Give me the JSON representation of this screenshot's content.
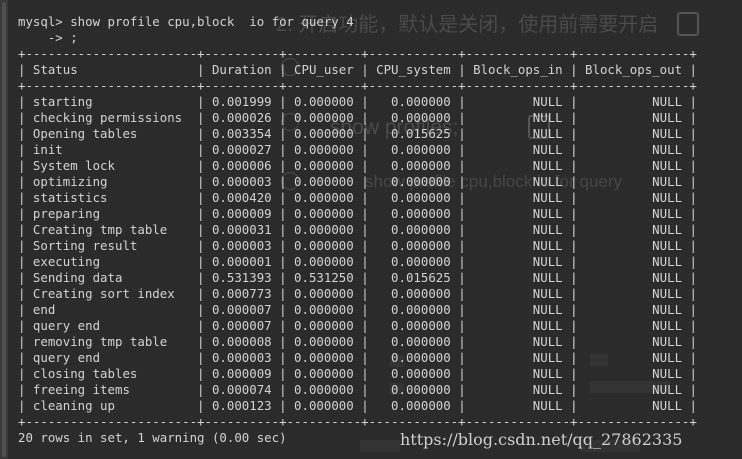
{
  "terminal": {
    "prompt_line": "mysql> show profile cpu,block  io for query 4",
    "continuation_line": "    -> ;",
    "border_line": "+-----------------------+----------+----------+------------+--------------+---------------+",
    "columns": [
      "Status",
      "Duration",
      "CPU_user",
      "CPU_system",
      "Block_ops_in",
      "Block_ops_out"
    ],
    "rows": [
      [
        "starting",
        "0.001999",
        "0.000000",
        "0.000000",
        "NULL",
        "NULL"
      ],
      [
        "checking permissions",
        "0.000026",
        "0.000000",
        "0.000000",
        "NULL",
        "NULL"
      ],
      [
        "Opening tables",
        "0.003354",
        "0.000000",
        "0.015625",
        "NULL",
        "NULL"
      ],
      [
        "init",
        "0.000027",
        "0.000000",
        "0.000000",
        "NULL",
        "NULL"
      ],
      [
        "System lock",
        "0.000006",
        "0.000000",
        "0.000000",
        "NULL",
        "NULL"
      ],
      [
        "optimizing",
        "0.000003",
        "0.000000",
        "0.000000",
        "NULL",
        "NULL"
      ],
      [
        "statistics",
        "0.000420",
        "0.000000",
        "0.000000",
        "NULL",
        "NULL"
      ],
      [
        "preparing",
        "0.000009",
        "0.000000",
        "0.000000",
        "NULL",
        "NULL"
      ],
      [
        "Creating tmp table",
        "0.000031",
        "0.000000",
        "0.000000",
        "NULL",
        "NULL"
      ],
      [
        "Sorting result",
        "0.000003",
        "0.000000",
        "0.000000",
        "NULL",
        "NULL"
      ],
      [
        "executing",
        "0.000001",
        "0.000000",
        "0.000000",
        "NULL",
        "NULL"
      ],
      [
        "Sending data",
        "0.531393",
        "0.531250",
        "0.015625",
        "NULL",
        "NULL"
      ],
      [
        "Creating sort index",
        "0.000773",
        "0.000000",
        "0.000000",
        "NULL",
        "NULL"
      ],
      [
        "end",
        "0.000007",
        "0.000000",
        "0.000000",
        "NULL",
        "NULL"
      ],
      [
        "query end",
        "0.000007",
        "0.000000",
        "0.000000",
        "NULL",
        "NULL"
      ],
      [
        "removing tmp table",
        "0.000008",
        "0.000000",
        "0.000000",
        "NULL",
        "NULL"
      ],
      [
        "query end",
        "0.000003",
        "0.000000",
        "0.000000",
        "NULL",
        "NULL"
      ],
      [
        "closing tables",
        "0.000009",
        "0.000000",
        "0.000000",
        "NULL",
        "NULL"
      ],
      [
        "freeing items",
        "0.000074",
        "0.000000",
        "0.000000",
        "NULL",
        "NULL"
      ],
      [
        "cleaning up",
        "0.000123",
        "0.000000",
        "0.000000",
        "NULL",
        "NULL"
      ]
    ],
    "result_line": "20 rows in set, 1 warning (0.00 sec)"
  },
  "watermark": {
    "url": "https://blog.csdn.net/qq_27862335",
    "background_title": "2. 开启功能，默认是关闭，使用前需要开启",
    "background_code": "show profiles;",
    "background_cmd": "show profile cpu,block io for query"
  },
  "colors": {
    "background": "#2b2b2b",
    "text": "#d3d3d3",
    "watermark_text": "#484848"
  }
}
